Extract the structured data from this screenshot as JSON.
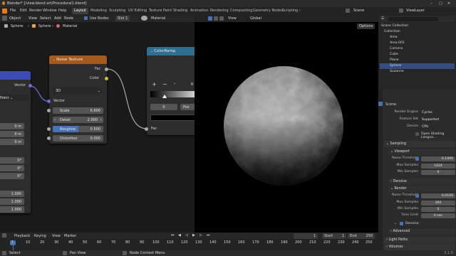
{
  "title": "Blender* [/view.blend art/Procedural1.blend]",
  "top_menu": [
    "File",
    "Edit",
    "Render",
    "Window",
    "Help"
  ],
  "workspaces": [
    "Layout",
    "Modeling",
    "Sculpting",
    "UV Editing",
    "Texture Paint",
    "Shading",
    "Animation",
    "Rendering",
    "Compositing",
    "Geometry Nodes",
    "Scripting"
  ],
  "active_workspace": "Layout",
  "scene_name": "Scene",
  "view_layer": "ViewLayer",
  "node_editor": {
    "header": {
      "mode": "Object",
      "menus": [
        "View",
        "Select",
        "Add",
        "Node"
      ],
      "use_nodes": "Use Nodes",
      "slot": "Slot 1",
      "material": "Material"
    },
    "breadcrumb": [
      "Sphere",
      "Sphere",
      "Material"
    ],
    "left_node": {
      "vector_label": "Vector",
      "point": "Point",
      "values": [
        "0 m",
        "0 m",
        "0 m",
        "0°",
        "0°",
        "0°",
        "1.000",
        "1.000",
        "1.000"
      ]
    },
    "noise_texture": {
      "title": "Noise Texture",
      "outputs": [
        "Fac",
        "Color"
      ],
      "dimension": "3D",
      "input_vector": "Vector",
      "scale_label": "Scale",
      "scale_value": "6.600",
      "detail_label": "Detail",
      "detail_value": "2.000",
      "roughness_label": "Roughne",
      "roughness_value": "0.500",
      "distortion_label": "Distortion",
      "distortion_value": "0.000"
    },
    "color_ramp": {
      "title": "ColorRamp",
      "add": "+",
      "remove": "−",
      "interp": "R",
      "pos_index": "0",
      "pos_label": "Pos",
      "input": "Fac"
    }
  },
  "viewport": {
    "orientation": "Global",
    "options": "Options"
  },
  "outliner": {
    "items": [
      {
        "name": "Scene Collection"
      },
      {
        "name": "Collection"
      },
      {
        "name": "Area"
      },
      {
        "name": "Area.001"
      },
      {
        "name": "Camera"
      },
      {
        "name": "Cube"
      },
      {
        "name": "Plane"
      },
      {
        "name": "Sphere"
      },
      {
        "name": "Suzanne"
      }
    ],
    "selected": "Sphere"
  },
  "properties": {
    "scene": "Scene",
    "render_engine_label": "Render Engine",
    "render_engine": "Cycles",
    "feature_set_label": "Feature Set",
    "feature_set": "Supported",
    "device_label": "Device",
    "device": "CPU",
    "osl_label": "Open Shading Langua...",
    "sampling": "Sampling",
    "viewport_section": "Viewport",
    "noise_threshold_label": "Noise Threshold",
    "vp_noise_threshold": "0.1000",
    "max_samples_label": "Max Samples",
    "vp_max_samples": "1024",
    "min_samples_label": "Min Samples",
    "vp_min_samples": "0",
    "denoise": "Denoise",
    "render_section": "Render",
    "r_noise_threshold": "0.0100",
    "r_max_samples": "300",
    "r_min_samples": "0",
    "time_limit_label": "Time Limit",
    "r_time_limit": "0 sec",
    "r_denoise": "Denoise",
    "advanced": "Advanced",
    "light_paths": "Light Paths",
    "volumes": "Volumes"
  },
  "timeline": {
    "menus": [
      "Playback",
      "Keying",
      "View",
      "Marker"
    ],
    "current_frame": "1",
    "start_label": "Start",
    "start": "1",
    "end_label": "End",
    "end": "250",
    "ticks": [
      "1",
      "10",
      "20",
      "30",
      "40",
      "50",
      "60",
      "70",
      "80",
      "90",
      "100",
      "110",
      "120",
      "130",
      "140",
      "150",
      "160",
      "170",
      "180",
      "190",
      "200",
      "210",
      "220",
      "230",
      "240",
      "250"
    ]
  },
  "status": {
    "select": "Select",
    "pan": "Pan View",
    "context": "Node Context Menu",
    "version": "3.1.0"
  },
  "colors": {
    "noise_header": "#a35a1a",
    "ramp_header": "#2f6f8f",
    "left_node_header": "#3b4bb0",
    "accent": "#4772b3"
  }
}
